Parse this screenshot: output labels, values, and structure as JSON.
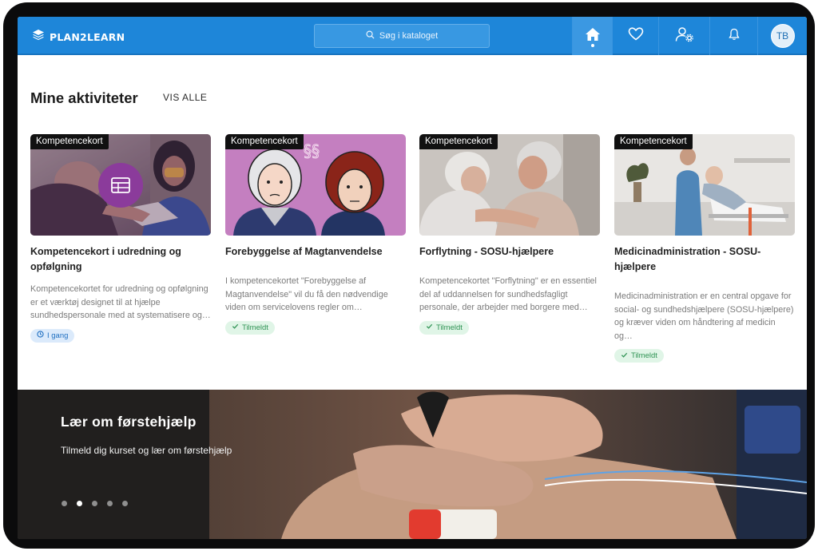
{
  "brand": {
    "name": "PLAN2LEARN"
  },
  "header": {
    "search_placeholder": "Søg i kataloget",
    "user_initials": "TB",
    "nav_icons": [
      "home-icon",
      "heart-icon",
      "user-settings-icon",
      "bell-icon"
    ]
  },
  "activities": {
    "title": "Mine aktiviteter",
    "view_all": "VIS ALLE",
    "cards": [
      {
        "badge": "Kompetencekort",
        "title": "Kompetencekort i udredning og opfølgning",
        "description": "Kompetencekortet for udredning og opfølgning er et værktøj designet til at hjælpe sundhedspersonale med at systematisere og…",
        "status": "I gang",
        "status_icon": "clock-icon"
      },
      {
        "badge": "Kompetencekort",
        "title": "Forebyggelse af Magtanvendelse",
        "description": "I kompetencekortet \"Forebyggelse af Magtanvendelse\" vil du få den nødvendige viden om servicelovens regler om…",
        "status": "Tilmeldt",
        "status_icon": "check-icon"
      },
      {
        "badge": "Kompetencekort",
        "title": "Forflytning - SOSU-hjælpere",
        "description": "Kompetencekortet \"Forflytning\" er en essentiel del af uddannelsen for sundhedsfagligt personale, der arbejder med borgere med…",
        "status": "Tilmeldt",
        "status_icon": "check-icon"
      },
      {
        "badge": "Kompetencekort",
        "title": "Medicinadministration - SOSU-hjælpere",
        "description": "Medicinadministration er en central opgave for social- og sundhedshjælpere (SOSU-hjælpere) og kræver viden om håndtering af medicin og…",
        "status": "Tilmeldt",
        "status_icon": "check-icon"
      }
    ]
  },
  "hero": {
    "title": "Lær om førstehjælp",
    "subtitle": "Tilmeld dig kurset og lær om førstehjælp",
    "slides": 5,
    "active_slide": 2
  },
  "colors": {
    "primary": "#1e86d9",
    "in_progress": "#1f6fc1",
    "enrolled": "#2f9354"
  }
}
